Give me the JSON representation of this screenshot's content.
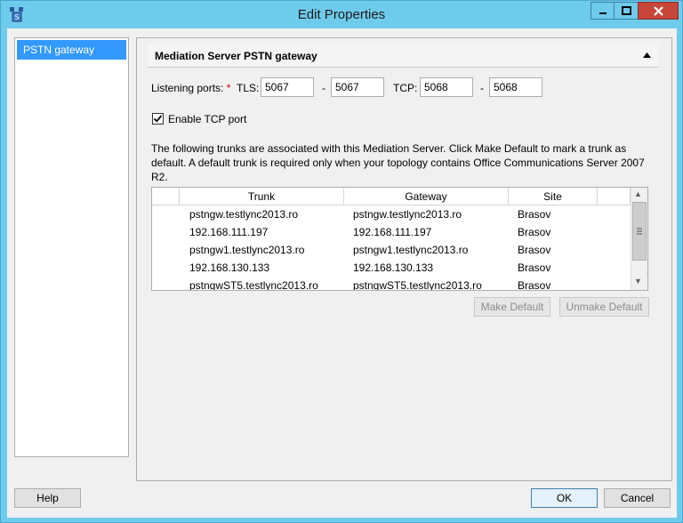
{
  "window": {
    "title": "Edit Properties"
  },
  "nav": {
    "items": [
      {
        "label": "PSTN gateway",
        "selected": true
      }
    ]
  },
  "section": {
    "title": "Mediation Server PSTN gateway"
  },
  "ports": {
    "label": "Listening ports:",
    "required_marker": "*",
    "tls_label": "TLS:",
    "tls_from": "5067",
    "tls_to": "5067",
    "separator": "-",
    "tcp_label": "TCP:",
    "tcp_from": "5068",
    "tcp_to": "5068"
  },
  "enable_tcp": {
    "label": "Enable TCP port",
    "checked": true
  },
  "description": "The following trunks are associated with this Mediation Server. Click Make Default to mark a trunk as default. A default trunk is required only when your topology contains Office Communications Server 2007 R2.",
  "trunks": {
    "columns": [
      "Trunk",
      "Gateway",
      "Site"
    ],
    "rows": [
      {
        "trunk": "pstngw.testlync2013.ro",
        "gateway": "pstngw.testlync2013.ro",
        "site": "Brasov"
      },
      {
        "trunk": "192.168.111.197",
        "gateway": "192.168.111.197",
        "site": "Brasov"
      },
      {
        "trunk": "pstngw1.testlync2013.ro",
        "gateway": "pstngw1.testlync2013.ro",
        "site": "Brasov"
      },
      {
        "trunk": "192.168.130.133",
        "gateway": "192.168.130.133",
        "site": "Brasov"
      },
      {
        "trunk": "pstngwST5.testlync2013.ro",
        "gateway": "pstngwST5.testlync2013.ro",
        "site": "Brasov"
      }
    ]
  },
  "buttons": {
    "make_default": "Make Default",
    "unmake_default": "Unmake Default",
    "help": "Help",
    "ok": "OK",
    "cancel": "Cancel"
  },
  "colors": {
    "title_bar": "#6fcbec",
    "selection": "#3399ff",
    "close_button": "#c7463a"
  }
}
